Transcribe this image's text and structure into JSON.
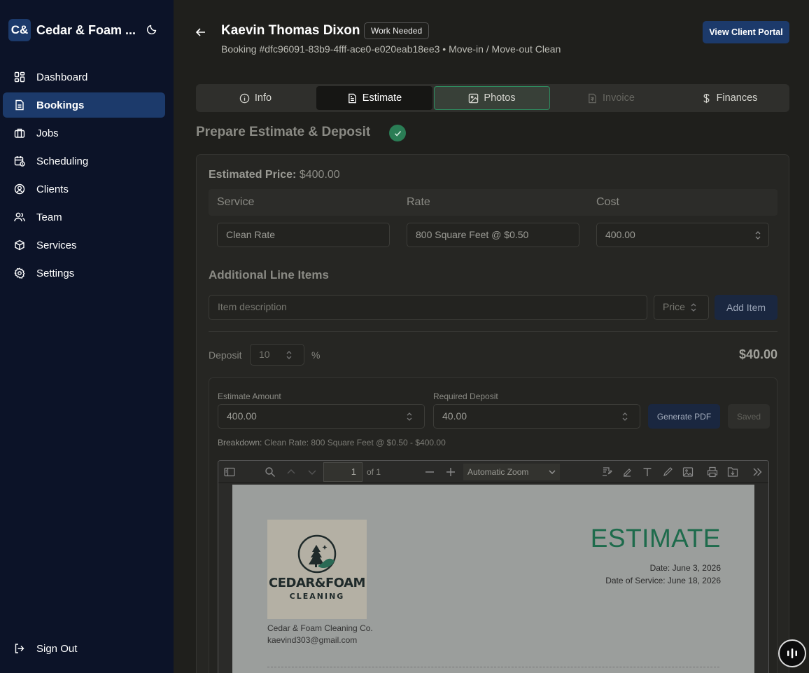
{
  "brand": {
    "logo": "C&",
    "name": "Cedar & Foam ..."
  },
  "nav": [
    {
      "label": "Dashboard",
      "icon": "dashboard-icon"
    },
    {
      "label": "Bookings",
      "icon": "bookings-icon",
      "active": true
    },
    {
      "label": "Jobs",
      "icon": "jobs-icon"
    },
    {
      "label": "Scheduling",
      "icon": "scheduling-icon"
    },
    {
      "label": "Clients",
      "icon": "clients-icon"
    },
    {
      "label": "Team",
      "icon": "team-icon"
    },
    {
      "label": "Services",
      "icon": "services-icon"
    },
    {
      "label": "Settings",
      "icon": "settings-icon"
    }
  ],
  "signout": "Sign Out",
  "header": {
    "title": "Kaevin Thomas Dixon",
    "badge": "Work Needed",
    "subtitle": "Booking #dfc96091-83b9-4fff-ace0-e020eab18ee3 • Move-in / Move-out Clean",
    "portal_button": "View Client Portal"
  },
  "tabs": [
    {
      "label": "Info",
      "icon": "info-icon"
    },
    {
      "label": "Estimate",
      "icon": "document-icon",
      "active": true
    },
    {
      "label": "Photos",
      "icon": "image-icon"
    },
    {
      "label": "Invoice",
      "icon": "invoice-icon",
      "disabled": true
    },
    {
      "label": "Finances",
      "icon": "dollar-icon"
    }
  ],
  "section_title": "Prepare Estimate & Deposit",
  "estimate": {
    "price_label": "Estimated Price:",
    "price_value": "$400.00",
    "columns": [
      "Service",
      "Rate",
      "Cost"
    ],
    "service_value": "Clean Rate",
    "rate_value": "800 Square Feet @ $0.50",
    "cost_value": "400.00",
    "additional_title": "Additional Line Items",
    "item_placeholder": "Item description",
    "price_placeholder": "Price",
    "add_button": "Add Item",
    "deposit_label": "Deposit",
    "deposit_value": "10",
    "deposit_unit": "%",
    "deposit_total": "$40.00"
  },
  "pdf_panel": {
    "estimate_amount_label": "Estimate Amount",
    "estimate_amount_value": "400.00",
    "required_deposit_label": "Required Deposit",
    "required_deposit_value": "40.00",
    "generate_button": "Generate PDF",
    "saved_button": "Saved",
    "breakdown_label": "Breakdown:",
    "breakdown_text": "Clean Rate: 800 Square Feet @ $0.50 - $400.00"
  },
  "viewer": {
    "page": "1",
    "page_of": "of 1",
    "zoom": "Automatic Zoom",
    "doc_title": "ESTIMATE",
    "date": "Date: June 3, 2026",
    "service_date": "Date of Service: June 18, 2026",
    "company": "Cedar & Foam Cleaning Co.",
    "email": "kaevind303@gmail.com",
    "logo_line1": "CEDAR&FOAM",
    "logo_line2": "CLEANING"
  },
  "colors": {
    "sidebar": "#0c1328",
    "accent": "#1c3a6b",
    "success": "#2a7d55",
    "estimate_title": "#1e6b4c"
  }
}
